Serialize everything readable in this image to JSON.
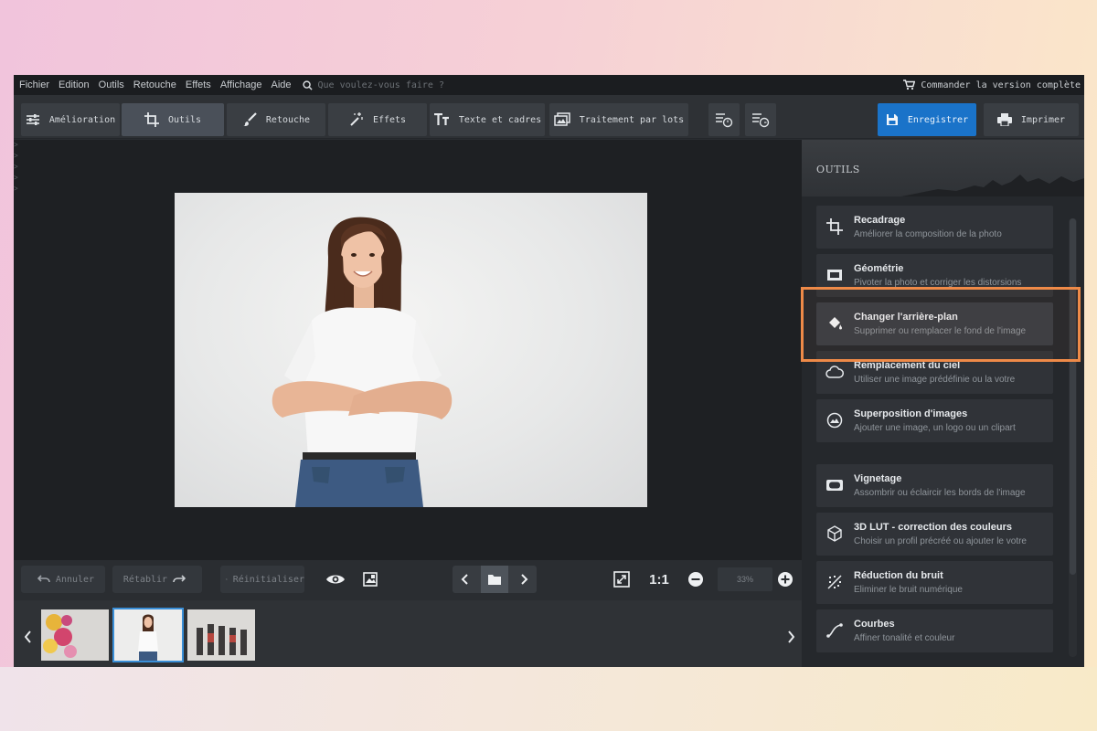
{
  "menu": {
    "items": [
      "Fichier",
      "Edition",
      "Outils",
      "Retouche",
      "Effets",
      "Affichage",
      "Aide"
    ],
    "search_placeholder": "Que voulez-vous faire ?",
    "order_label": "Commander la version complète"
  },
  "toolbar": {
    "tabs": [
      {
        "label": "Amélioration",
        "icon": "sliders-icon"
      },
      {
        "label": "Outils",
        "icon": "crop-icon",
        "active": true
      },
      {
        "label": "Retouche",
        "icon": "brush-icon"
      },
      {
        "label": "Effets",
        "icon": "magic-wand-icon"
      },
      {
        "label": "Texte et cadres",
        "icon": "text-icon"
      },
      {
        "label": "Traitement par lots",
        "icon": "batch-icon"
      }
    ],
    "save_label": "Enregistrer",
    "print_label": "Imprimer"
  },
  "controls": {
    "undo_label": "Annuler",
    "redo_label": "Rétablir",
    "reset_label": "Réinitialiser",
    "ratio_label": "1:1",
    "zoom_value": "33%"
  },
  "panel": {
    "title": "OUTILS",
    "tools": [
      {
        "name": "Recadrage",
        "desc": "Améliorer la composition de la photo",
        "icon": "crop-icon"
      },
      {
        "name": "Géométrie",
        "desc": "Pivoter la photo et corriger les distorsions",
        "icon": "geometry-icon"
      },
      {
        "name": "Changer l'arrière-plan",
        "desc": "Supprimer ou remplacer le fond de l'image",
        "icon": "paint-bucket-icon",
        "highlighted": true
      },
      {
        "name": "Remplacement du ciel",
        "desc": "Utiliser une image prédéfinie ou la votre",
        "icon": "cloud-icon"
      },
      {
        "name": "Superposition d'images",
        "desc": "Ajouter une image, un logo ou un clipart",
        "icon": "overlay-icon"
      },
      {
        "name": "Vignetage",
        "desc": "Assombrir ou éclaircir les bords de l'image",
        "icon": "vignette-icon"
      },
      {
        "name": "3D LUT - correction des couleurs",
        "desc": "Choisir un profil précréé ou ajouter le votre",
        "icon": "cube-icon"
      },
      {
        "name": "Réduction du bruit",
        "desc": "Eliminer le bruit numérique",
        "icon": "noise-icon"
      },
      {
        "name": "Courbes",
        "desc": "Affiner tonalité et couleur",
        "icon": "curves-icon"
      }
    ]
  },
  "colors": {
    "accent_blue": "#1a73c9",
    "highlight_orange": "#ee8a48"
  }
}
